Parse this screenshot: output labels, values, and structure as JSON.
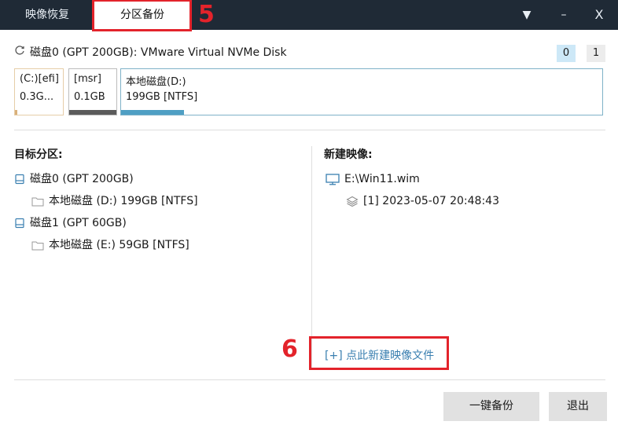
{
  "tabs": {
    "restore": "映像恢复",
    "backup": "分区备份"
  },
  "window": {
    "menu_icon": "▼",
    "minimize_icon": "–",
    "close_icon": "X"
  },
  "annotations": {
    "five": "5",
    "six": "6",
    "color": "#e3232b"
  },
  "disk_bar": {
    "title": "磁盘0 (GPT 200GB): VMware Virtual NVMe Disk",
    "disk_indexes": [
      "0",
      "1"
    ],
    "partitions": [
      {
        "line1": "(C:)[efi]",
        "line2": "0.3G...",
        "fill": 0.05,
        "color": "#d9b07a"
      },
      {
        "line1": "[msr]",
        "line2": "0.1GB",
        "fill": 1.0,
        "color": "#5b5b5b"
      },
      {
        "line1": "本地磁盘(D:)",
        "line2": "199GB [NTFS]",
        "fill": 0.13,
        "color": "#4f9fc4"
      }
    ]
  },
  "target": {
    "title": "目标分区:",
    "items": [
      {
        "label": "磁盘0 (GPT 200GB)",
        "type": "disk"
      },
      {
        "label": "本地磁盘 (D:) 199GB [NTFS]",
        "type": "partition"
      },
      {
        "label": "磁盘1 (GPT 60GB)",
        "type": "disk"
      },
      {
        "label": "本地磁盘 (E:) 59GB [NTFS]",
        "type": "partition"
      }
    ]
  },
  "new_image": {
    "title": "新建映像:",
    "file": "E:\\Win11.wim",
    "entry": "[1] 2023-05-07 20:48:43",
    "link": "[+] 点此新建映像文件"
  },
  "buttons": {
    "backup": "一键备份",
    "exit": "退出"
  },
  "colors": {
    "titlebar": "#1f2a36",
    "link": "#3a7fb0",
    "accent_selected": "#cde8f7"
  }
}
